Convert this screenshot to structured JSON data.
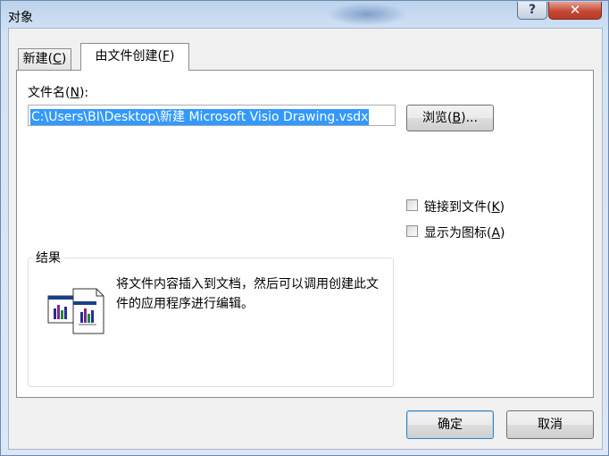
{
  "window": {
    "title": "对象",
    "help_label": "?",
    "close_label": "✕"
  },
  "tabs": [
    {
      "label_main": "新建(",
      "label_key": "C",
      "label_end": ")",
      "selected": false
    },
    {
      "label_main": "由文件创建(",
      "label_key": "F",
      "label_end": ")",
      "selected": true
    }
  ],
  "file": {
    "label_main": "文件名(",
    "label_key": "N",
    "label_end": "):",
    "value": "C:\\Users\\BI\\Desktop\\新建 Microsoft Visio Drawing.vsdx"
  },
  "browse": {
    "label_main": "浏览(",
    "label_key": "B",
    "label_end": ")..."
  },
  "options": {
    "link": {
      "label_main": "链接到文件(",
      "label_key": "K",
      "label_end": ")",
      "checked": false
    },
    "icon": {
      "label_main": "显示为图标(",
      "label_key": "A",
      "label_end": ")",
      "checked": false
    }
  },
  "result": {
    "title": "结果",
    "text": "将文件内容插入到文档，然后可以调用创建此文件的应用程序进行编辑。",
    "icon": "embed-file-chart-icon"
  },
  "buttons": {
    "ok": "确定",
    "cancel": "取消"
  }
}
